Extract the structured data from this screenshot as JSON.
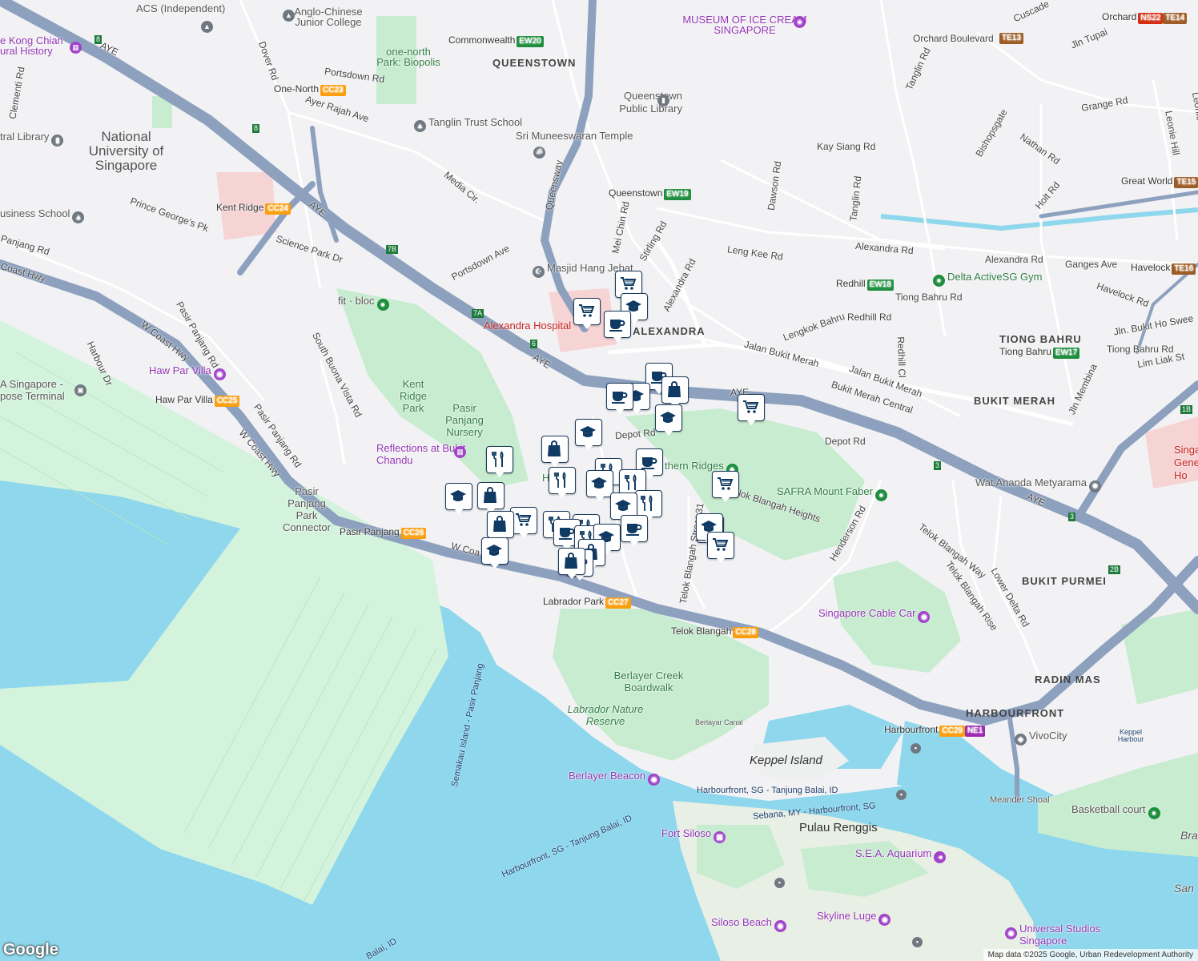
{
  "attribution": "Map data ©2025 Google, Urban Redevelopment Authority",
  "logo_text": "Google",
  "area_labels": {
    "nus": "National University of Singapore",
    "kong_chian": "e Kong Chian ural History",
    "one_north_park": "one-north Park: Biopolis",
    "anglo_chinese": "Anglo-Chinese Junior College",
    "acs": "ACS (Independent)",
    "museum_ice_cream": "MUSEUM OF ICE CREAM SINGAPORE"
  },
  "districts": {
    "queenstown": "QUEENSTOWN",
    "alexandra": "ALEXANDRA",
    "tiong_bahru": "TIONG BAHRU",
    "bukit_merah": "BUKIT MERAH",
    "bukit_purmei": "BUKIT PURMEI",
    "radin_mas": "RADIN MAS",
    "harbourfront": "HARBOURFRONT"
  },
  "roads": {
    "aye_1": "AYE",
    "aye_2": "AYE",
    "aye_3": "AYE",
    "aye_4": "AYE",
    "aye_5": "AYE",
    "w_coast_hwy_1": "W Coast Hwy",
    "w_coast_hwy_2": "W Coast Hwy",
    "w_coast_1": "W Coa",
    "coast_hwy": "Coast Hwy",
    "dover_rd": "Dover Rd",
    "portsdown_rd": "Portsdown Rd",
    "portsdown_ave": "Portsdown Ave",
    "ayer_rajah": "Ayer Rajah Ave",
    "queensway": "Queensway",
    "media_cir": "Media Cir.",
    "prince_george": "Prince George's Pk",
    "science_park": "Science Park Dr",
    "clementi_rd": "Clementi Rd",
    "panjang_rd": "Panjang Rd",
    "pasir_panjang_rd_1": "Pasir Panjang Rd",
    "pasir_panjang_rd_2": "Pasir Panjang Rd",
    "harbour_dr": "Harbour Dr",
    "south_buona_vista": "South Buona Vista Rd",
    "mei_chin": "Mei Chin Rd",
    "stirling": "Stirling Rd",
    "alexandra_rd": "Alexandra Rd",
    "alexandra_rd_2": "Alexandra Rd",
    "alexandra_rd_3": "Alexandra Rd",
    "leng_kee": "Leng Kee Rd",
    "dawson": "Dawson Rd",
    "tanglin_rd": "Tanglin Rd",
    "tanglin_rd_2": "Tanglin Rd",
    "kay_siang": "Kay Siang Rd",
    "jalan_bukit_merah_1": "Jalan Bukit Merah",
    "jalan_bukit_merah_2": "Jalan Bukit Merah",
    "bukit_merah_central": "Bukit Merah Central",
    "lengkok_bahru": "Lengkok Bahru",
    "redhill_rd": "Redhill Rd",
    "redhill_cl": "Redhill Cl",
    "tiong_bahru_rd": "Tiong Bahru Rd",
    "tiong_bahru_rd_2": "Tiong Bahru Rd",
    "depot_rd_1": "Depot Rd",
    "depot_rd_2": "Depot Rd",
    "henderson": "Henderson Rd",
    "telok_blangah_heights": "lok Blangah Heights",
    "telok_blangah_st31": "Telok Blangah Street 31",
    "telok_blangah_way": "Telok Blangah Way",
    "telok_blangah_rise": "Telok Blangah Rise",
    "lower_delta": "Lower Delta Rd",
    "grange": "Grange Rd",
    "orchard_blvd": "Orchard Boulevard",
    "jln_tupai": "Jln Tupai",
    "bishopsgate": "Bishopsgate",
    "nathan": "Nathan Rd",
    "holt": "Holt Rd",
    "ganges": "Ganges Ave",
    "havelock_rd": "Havelock Rd",
    "jln_bukit_ho_swee": "Jln. Bukit Ho Swee",
    "lim_liak": "Lim Liak St",
    "jln_membina": "Jln Membina",
    "leonie_hill": "Leonie Hill",
    "leonie_hill_rd": "Leonie Hill Rd",
    "cuscaden": "Cuscade"
  },
  "exits": [
    "8",
    "8",
    "7B",
    "7A",
    "6",
    "3",
    "3",
    "2B",
    "1B"
  ],
  "places": {
    "tanglin_trust": "Tanglin Trust School",
    "sri_munee": "Sri Muneeswaran Temple",
    "queenstown_library": "Queenstown Public Library",
    "national_library": "tral Library",
    "business_school": "usiness School",
    "masjid": "Masjid Hang Jebat",
    "fit_bloc": "fit · bloc",
    "pasir_panjang_nursery": "Pasir Panjang Nursery",
    "pasir_panjang_connector": "Pasir Panjang Park Connector",
    "wat_ananda": "Wat Ananda Metyarama",
    "psa": "A Singapore - pose Terminal",
    "meander": "Meander Shoal",
    "keppel_harbour": "Keppel Harbour",
    "berlayar": "Berlayar Canal",
    "basketball": "Basketball court",
    "vivocity": "VivoCity",
    "singapore_general": "Singa General Ho",
    "bra": "Bra",
    "san": "San"
  },
  "parks": {
    "kent_ridge_park": "Kent Ridge Park",
    "southern_ridges": "thern Ridges",
    "hort_park": "H",
    "berlayer_creek": "Berlayer Creek Boardwalk",
    "labrador_nature": "Labrador Nature Reserve",
    "safra": "SAFRA Mount Faber",
    "delta_activesg": "Delta ActiveSG Gym"
  },
  "attractions": {
    "haw_par_villa": "Haw Par Villa",
    "reflections": "Reflections at Bukit Chandu",
    "cable_car": "Singapore Cable Car",
    "berlayer_beacon": "Berlayer Beacon",
    "fort_siloso": "Fort Siloso",
    "sea_aquarium": "S.E.A. Aquarium",
    "skyline_luge": "Skyline Luge",
    "siloso_beach": "Siloso Beach",
    "universal": "Universal Studios Singapore"
  },
  "hospital": "Alexandra Hospital",
  "islands": {
    "keppel": "Keppel Island",
    "pulau_renggis": "Pulau Renggis"
  },
  "ferries": {
    "route1": "Harbourfront, SG - Tanjung Balai, ID",
    "route2": "Sebana, MY - Harbourfront, SG",
    "route3": "Harbourfront, SG - Tanjung Balai, ID",
    "semakau": "Semakau Island - Pasir Panjang",
    "balai": "Balai, ID"
  },
  "stations": [
    {
      "key": "commonwealth",
      "name": "Commonwealth",
      "code": "EW20",
      "color": "#1e8e3e"
    },
    {
      "key": "queenstown",
      "name": "Queenstown",
      "code": "EW19",
      "color": "#1e8e3e"
    },
    {
      "key": "redhill",
      "name": "Redhill",
      "code": "EW18",
      "color": "#1e8e3e"
    },
    {
      "key": "tiong_bahru",
      "name": "Tiong Bahru",
      "code": "EW17",
      "color": "#1e8e3e"
    },
    {
      "key": "havelock",
      "name": "Havelock",
      "code": "TE16",
      "color": "#9d5b25"
    },
    {
      "key": "great_world",
      "name": "Great World",
      "code": "TE15",
      "color": "#9d5b25"
    },
    {
      "key": "orchard_blvd",
      "name": "",
      "code": "TE13",
      "color": "#9d5b25"
    },
    {
      "key": "orchard",
      "name": "Orchard",
      "code": "NS22",
      "code2": "TE14",
      "color": "#d42e12",
      "color2": "#9d5b25"
    },
    {
      "key": "one_north",
      "name": "One-North",
      "code": "CC23",
      "color": "#fa9e0d"
    },
    {
      "key": "kent_ridge",
      "name": "Kent Ridge",
      "code": "CC24",
      "color": "#fa9e0d"
    },
    {
      "key": "haw_par",
      "name": "Haw Par Villa",
      "code": "CC25",
      "color": "#fa9e0d"
    },
    {
      "key": "pasir_panjang",
      "name": "Pasir Panjang",
      "code": "CC26",
      "color": "#fa9e0d"
    },
    {
      "key": "labrador",
      "name": "Labrador Park",
      "code": "CC27",
      "color": "#fa9e0d"
    },
    {
      "key": "telok_blangah",
      "name": "Telok Blangah",
      "code": "CC28",
      "color": "#fa9e0d"
    },
    {
      "key": "harbourfront",
      "name": "Harbourfront",
      "code": "CC29",
      "code2": "NE1",
      "color": "#fa9e0d",
      "color2": "#9c27b0"
    }
  ],
  "markers": [
    {
      "type": "cart"
    },
    {
      "type": "school"
    },
    {
      "type": "cart"
    },
    {
      "type": "cafe"
    },
    {
      "type": "cafe"
    },
    {
      "type": "school"
    },
    {
      "type": "cafe"
    },
    {
      "type": "shop"
    },
    {
      "type": "school"
    },
    {
      "type": "cart"
    },
    {
      "type": "shop"
    },
    {
      "type": "school"
    },
    {
      "type": "food"
    },
    {
      "type": "food"
    },
    {
      "type": "cafe"
    },
    {
      "type": "food"
    },
    {
      "type": "school"
    },
    {
      "type": "food"
    },
    {
      "type": "cart"
    },
    {
      "type": "school"
    },
    {
      "type": "shop"
    },
    {
      "type": "food"
    },
    {
      "type": "school"
    },
    {
      "type": "food"
    },
    {
      "type": "cart"
    },
    {
      "type": "shop"
    },
    {
      "type": "cart"
    },
    {
      "type": "school"
    },
    {
      "type": "food"
    },
    {
      "type": "cafe"
    },
    {
      "type": "food"
    },
    {
      "type": "school"
    },
    {
      "type": "cafe"
    },
    {
      "type": "school"
    },
    {
      "type": "cart"
    },
    {
      "type": "shop"
    },
    {
      "type": "cafe"
    },
    {
      "type": "shop"
    }
  ],
  "colors": {
    "water": "#8ed7ec",
    "land": "#f2f2f4",
    "park": "#c7eccf",
    "expressway": "#8da1bf",
    "marker_icon": "#0f3a63",
    "reclaimed": "#d4f3dc"
  }
}
